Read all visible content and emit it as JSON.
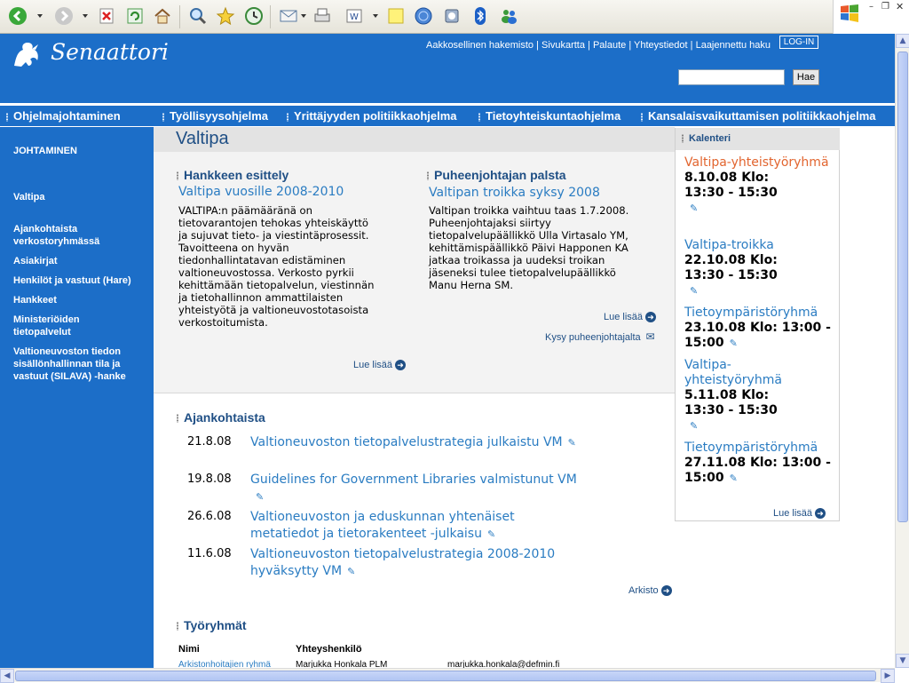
{
  "site": {
    "title": "Senaattori"
  },
  "header": {
    "links": [
      "Aakkosellinen hakemisto",
      "Sivukartta",
      "Palaute",
      "Yhteystiedot",
      "Laajennettu haku"
    ],
    "login_label": "LOG-IN",
    "search_placeholder": "",
    "search_button": "Hae"
  },
  "nav": {
    "items": [
      "Ohjelmajohtaminen",
      "Työllisyysohjelma",
      "Yrittäjyyden politiikkaohjelma",
      "Tietoyhteiskuntaohjelma",
      "Kansalaisvaikuttamisen politiikkaohjelma"
    ]
  },
  "sidebar": {
    "heading": "JOHTAMINEN",
    "items": [
      "Valtipa",
      "Ajankohtaista verkostoryhmässä",
      "Asiakirjat",
      "Henkilöt ja vastuut (Hare)",
      "Hankkeet",
      "Ministeriöiden tietopalvelut",
      "Valtioneuvoston tiedon sisällönhallinnan tila ja vastuut (SILAVA) -hanke"
    ]
  },
  "main": {
    "title": "Valtipa",
    "left_section": {
      "heading": "Hankkeen esittely",
      "title": "Valtipa vuosille 2008-2010",
      "body": "VALTIPA:n päämääränä on tietovarantojen tehokas yhteiskäyttö ja sujuvat tieto- ja viestintäprosessit. Tavoitteena on hyvän tiedonhallintatavan edistäminen valtioneuvostossa. Verkosto pyrkii kehittämään tietopalvelun, viestinnän ja tietohallinnon ammattilaisten yhteistyötä ja valtioneuvostotasoista verkostoitumista.",
      "more": "Lue lisää"
    },
    "right_section": {
      "heading": "Puheenjohtajan palsta",
      "title": "Valtipan troikka syksy 2008",
      "body": "Valtipan troikka vaihtuu taas 1.7.2008. Puheenjohtajaksi siirtyy tietopalvelupäällikkö Ulla Virtasalo YM, kehittämispäällikkö Päivi Happonen KA jatkaa troikassa ja uudeksi troikan jäseneksi tulee tietopalvelupäällikkö Manu Herna SM.",
      "more": "Lue lisää",
      "ask": "Kysy puheenjohtajalta"
    },
    "news": {
      "heading": "Ajankohtaista",
      "items": [
        {
          "date": "21.8.08",
          "title": "Valtioneuvoston tietopalvelustrategia julkaistu VM"
        },
        {
          "date": "19.8.08",
          "title": "Guidelines for Government Libraries valmistunut VM"
        },
        {
          "date": "26.6.08",
          "title": "Valtioneuvoston ja eduskunnan yhtenäiset metatiedot ja tietorakenteet -julkaisu"
        },
        {
          "date": "11.6.08",
          "title": "Valtioneuvoston tietopalvelustrategia 2008-2010 hyväksytty VM"
        }
      ],
      "archive": "Arkisto"
    },
    "groups": {
      "heading": "Työryhmät",
      "col_name": "Nimi",
      "col_contact": "Yhteyshenkilö",
      "rows": [
        {
          "name": "Arkistonhoitajien ryhmä",
          "contact": "Marjukka Honkala PLM",
          "email": "marjukka.honkala@defmin.fi"
        }
      ]
    }
  },
  "calendar": {
    "heading": "Kalenteri",
    "items": [
      {
        "name": "Valtipa-yhteistyöryhmä",
        "time": "8.10.08 Klo: 13:30 - 15:30",
        "highlight": true
      },
      {
        "name": "Valtipa-troikka",
        "time": "22.10.08 Klo: 13:30 - 15:30",
        "highlight": false
      },
      {
        "name": "Tietoympäristöryhmä",
        "time": "23.10.08 Klo: 13:00 - 15:00",
        "highlight": false
      },
      {
        "name": "Valtipa-yhteistyöryhmä",
        "time": "5.11.08 Klo: 13:30 - 15:30",
        "highlight": false
      },
      {
        "name": "Tietoympäristöryhmä",
        "time": "27.11.08 Klo: 13:00 - 15:00",
        "highlight": false
      }
    ],
    "more": "Lue lisää"
  },
  "colors": {
    "brand": "#1c6ec8",
    "link": "#2a7cc2",
    "highlight": "#e2652f",
    "heading": "#1f4f85"
  },
  "icons": [
    "back-icon",
    "forward-icon",
    "stop-icon",
    "refresh-icon",
    "home-icon",
    "search-icon",
    "favorites-icon",
    "history-icon",
    "mail-icon",
    "print-icon",
    "edit-icon",
    "notes-icon",
    "globe-icon",
    "media-icon",
    "bluetooth-icon",
    "messenger-icon",
    "windows-logo-icon"
  ]
}
